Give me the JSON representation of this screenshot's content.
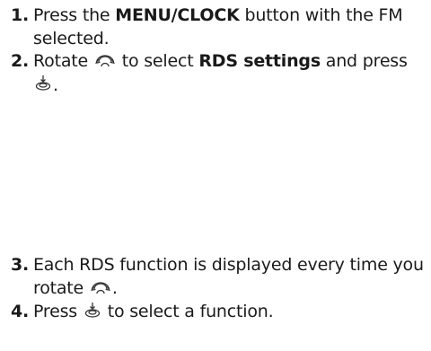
{
  "steps": [
    {
      "number": "1.",
      "pre": "Press the ",
      "bold": "MENU/CLOCK",
      "post": " button with the FM selected."
    },
    {
      "number": "2.",
      "pre": "Rotate ",
      "icon1": "rotate-knob-icon",
      "mid": " to select ",
      "bold": "RDS settings",
      "post": " and press",
      "icon2": "push-knob-icon",
      "end": "."
    },
    {
      "number": "3.",
      "pre": "Each RDS function is displayed every time you rotate ",
      "icon1": "rotate-knob-icon",
      "end": "."
    },
    {
      "number": "4.",
      "pre": "Press ",
      "icon1": "push-knob-icon",
      "post": " to select a function."
    }
  ]
}
